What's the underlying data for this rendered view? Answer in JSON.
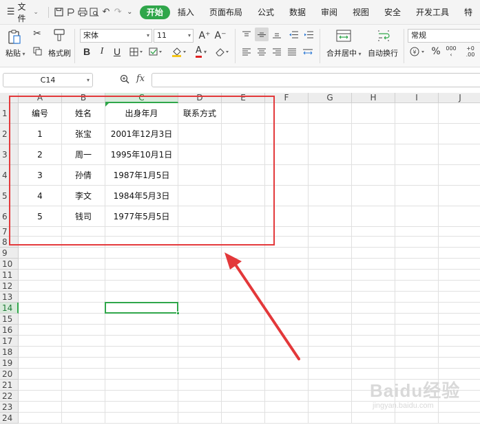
{
  "menubar": {
    "file_label": "文件",
    "tabs": [
      "开始",
      "插入",
      "页面布局",
      "公式",
      "数据",
      "审阅",
      "视图",
      "安全",
      "开发工具",
      "特"
    ],
    "active_tab": 0
  },
  "ribbon": {
    "paste_label": "粘贴",
    "format_painter_label": "格式刷",
    "font_name": "宋体",
    "font_size": "11",
    "merge_label": "合并居中",
    "wrap_label": "自动换行",
    "number_format": "常规",
    "bold": "B",
    "italic": "I",
    "underline": "U",
    "font_color_glyph": "A",
    "grow_font": "A⁺",
    "shrink_font": "A⁻",
    "percent": "%",
    "thousands": "000",
    "decimal_add": "+0",
    "decimal_sub": ".00"
  },
  "formula_bar": {
    "cell_ref": "C14",
    "fx_label": "fx",
    "formula": ""
  },
  "sheet": {
    "columns": [
      "A",
      "B",
      "C",
      "D",
      "E",
      "F",
      "G",
      "H",
      "I",
      "J"
    ],
    "rows": [
      "1",
      "2",
      "3",
      "4",
      "5",
      "6",
      "7",
      "8",
      "9",
      "10",
      "11",
      "12",
      "13",
      "14",
      "15",
      "16",
      "17",
      "18",
      "19",
      "20",
      "21",
      "22",
      "23",
      "24"
    ],
    "selected_column": "C",
    "selected_row": "14",
    "table": [
      [
        "编号",
        "姓名",
        "出身年月",
        "联系方式"
      ],
      [
        "1",
        "张宝",
        "2001年12月3日",
        ""
      ],
      [
        "2",
        "周一",
        "1995年10月1日",
        ""
      ],
      [
        "3",
        "孙倩",
        "1987年1月5日",
        ""
      ],
      [
        "4",
        "李文",
        "1984年5月3日",
        ""
      ],
      [
        "5",
        "钱司",
        "1977年5月5日",
        ""
      ]
    ]
  },
  "annotation": {
    "box_color": "#e3383a",
    "arrow_color": "#e3383a"
  },
  "watermark": {
    "main": "Baidu经验",
    "sub": "jingyan.baidu.com"
  },
  "colors": {
    "accent": "#2fa64a",
    "header_bg": "#ededed"
  }
}
